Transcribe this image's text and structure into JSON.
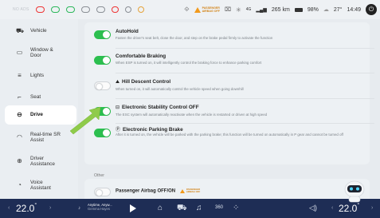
{
  "status": {
    "left_tag": "NO ADS",
    "airbag_line1": "PASSENGER",
    "airbag_line2": "AIRBAG",
    "airbag_state": "OFF",
    "network": "4G",
    "range": "265 km",
    "battery": "98%",
    "outside_temp": "27°",
    "time": "14:49"
  },
  "sidebar": {
    "items": [
      {
        "label": "Vehicle",
        "icon": "car-icon"
      },
      {
        "label": "Window & Door",
        "icon": "window-icon"
      },
      {
        "label": "Lights",
        "icon": "light-icon"
      },
      {
        "label": "Seat",
        "icon": "seat-icon"
      },
      {
        "label": "Drive",
        "icon": "steering-wheel-icon"
      },
      {
        "label": "Real-time SR Assist",
        "icon": "sr-assist-icon"
      },
      {
        "label": "Driver Assistance",
        "icon": "driver-assist-icon"
      },
      {
        "label": "Voice Assistant",
        "icon": "voice-icon"
      }
    ]
  },
  "main": {
    "rows": [
      {
        "title": "AutoHold",
        "desc": "Fasten the driver's seat belt, close the door, and step on the brake pedal firmly to activate the function",
        "on": true
      },
      {
        "title": "Comfortable Braking",
        "desc": "When ESP is turned on, it will intelligently control the braking force to enhance parking comfort",
        "on": true
      },
      {
        "title": "Hill Descent Control",
        "desc": "When turned on, it will automatically control the vehicle speed when going downhill",
        "on": false
      },
      {
        "title": "Electronic Stability Control OFF",
        "desc": "The ESC system will automatically reactivate when the vehicle is restarted or driven at high speed",
        "on": true
      },
      {
        "title": "Electronic Parking Brake",
        "desc": "After it is turned on, the vehicle will be parked with the parking brake; this function will be turned on automatically in P gear and cannot be turned off",
        "on": true
      }
    ],
    "section_other": "Other",
    "passenger_airbag": {
      "title": "Passenger Airbag OFF/ON",
      "on": false,
      "badge_line1": "PASSENGER",
      "badge_line2": "AIRBAG OFF"
    }
  },
  "bottom": {
    "left_temp": "22.0",
    "right_temp": "22.0",
    "media_title": "Anytime, Anyw...",
    "media_artist": "Gemma Hayes",
    "fan_label": "360"
  },
  "colors": {
    "toggle_on": "#2cbf4f",
    "arrow": "#8fcb4a",
    "bottom_bar": "#1e2d55"
  }
}
